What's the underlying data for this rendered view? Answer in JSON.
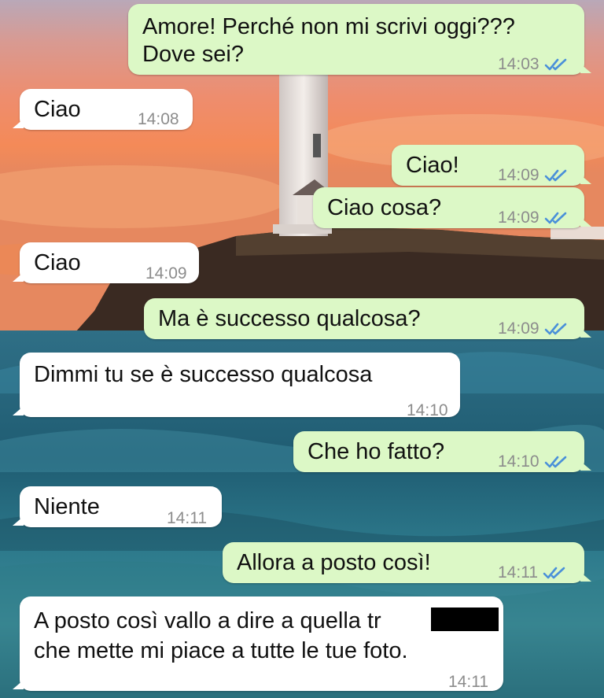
{
  "colors": {
    "incoming_bubble": "#ffffff",
    "outgoing_bubble": "#dcf8c6",
    "read_ticks": "#4a90d9",
    "timestamp": "#8c8c8c"
  },
  "messages": [
    {
      "dir": "out",
      "lines": [
        "Amore! Perché non mi scrivi oggi???",
        "Dove sei?"
      ],
      "time": "14:03",
      "status": "read-ticks-icon"
    },
    {
      "dir": "in",
      "lines": [
        "Ciao"
      ],
      "time": "14:08"
    },
    {
      "dir": "out",
      "lines": [
        "Ciao!"
      ],
      "time": "14:09",
      "status": "read-ticks-icon"
    },
    {
      "dir": "out",
      "lines": [
        "Ciao cosa?"
      ],
      "time": "14:09",
      "status": "read-ticks-icon"
    },
    {
      "dir": "in",
      "lines": [
        "Ciao"
      ],
      "time": "14:09"
    },
    {
      "dir": "out",
      "lines": [
        "Ma è successo qualcosa?"
      ],
      "time": "14:09",
      "status": "read-ticks-icon"
    },
    {
      "dir": "in",
      "lines": [
        "Dimmi tu se è successo qualcosa"
      ],
      "time": "14:10"
    },
    {
      "dir": "out",
      "lines": [
        "Che ho fatto?"
      ],
      "time": "14:10",
      "status": "read-ticks-icon"
    },
    {
      "dir": "in",
      "lines": [
        "Niente"
      ],
      "time": "14:11"
    },
    {
      "dir": "out",
      "lines": [
        "Allora a posto così!"
      ],
      "time": "14:11",
      "status": "read-ticks-icon"
    },
    {
      "dir": "in",
      "lines": [
        "A posto così vallo a dire a quella tr",
        "che mette mi piace a tutte le tue foto."
      ],
      "time": "14:11",
      "redacted": true
    }
  ]
}
